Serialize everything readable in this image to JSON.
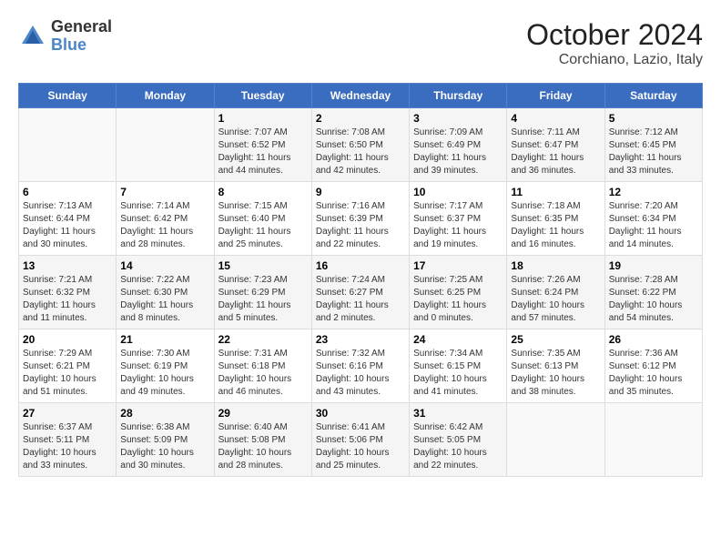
{
  "logo": {
    "line1": "General",
    "line2": "Blue"
  },
  "title": "October 2024",
  "subtitle": "Corchiano, Lazio, Italy",
  "weekdays": [
    "Sunday",
    "Monday",
    "Tuesday",
    "Wednesday",
    "Thursday",
    "Friday",
    "Saturday"
  ],
  "weeks": [
    [
      {
        "day": "",
        "info": ""
      },
      {
        "day": "",
        "info": ""
      },
      {
        "day": "1",
        "info": "Sunrise: 7:07 AM\nSunset: 6:52 PM\nDaylight: 11 hours and 44 minutes."
      },
      {
        "day": "2",
        "info": "Sunrise: 7:08 AM\nSunset: 6:50 PM\nDaylight: 11 hours and 42 minutes."
      },
      {
        "day": "3",
        "info": "Sunrise: 7:09 AM\nSunset: 6:49 PM\nDaylight: 11 hours and 39 minutes."
      },
      {
        "day": "4",
        "info": "Sunrise: 7:11 AM\nSunset: 6:47 PM\nDaylight: 11 hours and 36 minutes."
      },
      {
        "day": "5",
        "info": "Sunrise: 7:12 AM\nSunset: 6:45 PM\nDaylight: 11 hours and 33 minutes."
      }
    ],
    [
      {
        "day": "6",
        "info": "Sunrise: 7:13 AM\nSunset: 6:44 PM\nDaylight: 11 hours and 30 minutes."
      },
      {
        "day": "7",
        "info": "Sunrise: 7:14 AM\nSunset: 6:42 PM\nDaylight: 11 hours and 28 minutes."
      },
      {
        "day": "8",
        "info": "Sunrise: 7:15 AM\nSunset: 6:40 PM\nDaylight: 11 hours and 25 minutes."
      },
      {
        "day": "9",
        "info": "Sunrise: 7:16 AM\nSunset: 6:39 PM\nDaylight: 11 hours and 22 minutes."
      },
      {
        "day": "10",
        "info": "Sunrise: 7:17 AM\nSunset: 6:37 PM\nDaylight: 11 hours and 19 minutes."
      },
      {
        "day": "11",
        "info": "Sunrise: 7:18 AM\nSunset: 6:35 PM\nDaylight: 11 hours and 16 minutes."
      },
      {
        "day": "12",
        "info": "Sunrise: 7:20 AM\nSunset: 6:34 PM\nDaylight: 11 hours and 14 minutes."
      }
    ],
    [
      {
        "day": "13",
        "info": "Sunrise: 7:21 AM\nSunset: 6:32 PM\nDaylight: 11 hours and 11 minutes."
      },
      {
        "day": "14",
        "info": "Sunrise: 7:22 AM\nSunset: 6:30 PM\nDaylight: 11 hours and 8 minutes."
      },
      {
        "day": "15",
        "info": "Sunrise: 7:23 AM\nSunset: 6:29 PM\nDaylight: 11 hours and 5 minutes."
      },
      {
        "day": "16",
        "info": "Sunrise: 7:24 AM\nSunset: 6:27 PM\nDaylight: 11 hours and 2 minutes."
      },
      {
        "day": "17",
        "info": "Sunrise: 7:25 AM\nSunset: 6:25 PM\nDaylight: 11 hours and 0 minutes."
      },
      {
        "day": "18",
        "info": "Sunrise: 7:26 AM\nSunset: 6:24 PM\nDaylight: 10 hours and 57 minutes."
      },
      {
        "day": "19",
        "info": "Sunrise: 7:28 AM\nSunset: 6:22 PM\nDaylight: 10 hours and 54 minutes."
      }
    ],
    [
      {
        "day": "20",
        "info": "Sunrise: 7:29 AM\nSunset: 6:21 PM\nDaylight: 10 hours and 51 minutes."
      },
      {
        "day": "21",
        "info": "Sunrise: 7:30 AM\nSunset: 6:19 PM\nDaylight: 10 hours and 49 minutes."
      },
      {
        "day": "22",
        "info": "Sunrise: 7:31 AM\nSunset: 6:18 PM\nDaylight: 10 hours and 46 minutes."
      },
      {
        "day": "23",
        "info": "Sunrise: 7:32 AM\nSunset: 6:16 PM\nDaylight: 10 hours and 43 minutes."
      },
      {
        "day": "24",
        "info": "Sunrise: 7:34 AM\nSunset: 6:15 PM\nDaylight: 10 hours and 41 minutes."
      },
      {
        "day": "25",
        "info": "Sunrise: 7:35 AM\nSunset: 6:13 PM\nDaylight: 10 hours and 38 minutes."
      },
      {
        "day": "26",
        "info": "Sunrise: 7:36 AM\nSunset: 6:12 PM\nDaylight: 10 hours and 35 minutes."
      }
    ],
    [
      {
        "day": "27",
        "info": "Sunrise: 6:37 AM\nSunset: 5:11 PM\nDaylight: 10 hours and 33 minutes."
      },
      {
        "day": "28",
        "info": "Sunrise: 6:38 AM\nSunset: 5:09 PM\nDaylight: 10 hours and 30 minutes."
      },
      {
        "day": "29",
        "info": "Sunrise: 6:40 AM\nSunset: 5:08 PM\nDaylight: 10 hours and 28 minutes."
      },
      {
        "day": "30",
        "info": "Sunrise: 6:41 AM\nSunset: 5:06 PM\nDaylight: 10 hours and 25 minutes."
      },
      {
        "day": "31",
        "info": "Sunrise: 6:42 AM\nSunset: 5:05 PM\nDaylight: 10 hours and 22 minutes."
      },
      {
        "day": "",
        "info": ""
      },
      {
        "day": "",
        "info": ""
      }
    ]
  ]
}
